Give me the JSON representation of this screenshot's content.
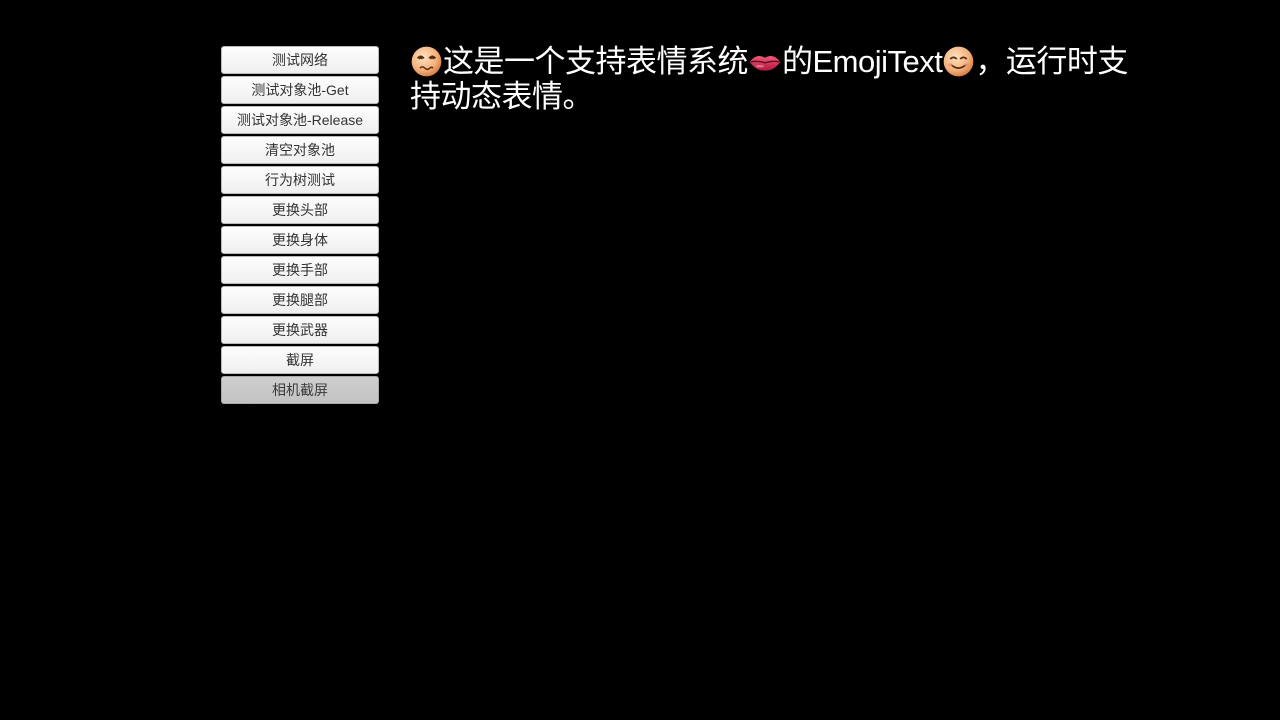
{
  "buttons": [
    {
      "label": "测试网络"
    },
    {
      "label": "测试对象池-Get"
    },
    {
      "label": "测试对象池-Release"
    },
    {
      "label": "清空对象池"
    },
    {
      "label": "行为树测试"
    },
    {
      "label": "更换头部"
    },
    {
      "label": "更换身体"
    },
    {
      "label": "更换手部"
    },
    {
      "label": "更换腿部"
    },
    {
      "label": "更换武器"
    },
    {
      "label": "截屏"
    },
    {
      "label": "相机截屏",
      "state": "pressed"
    }
  ],
  "emoji_text": {
    "emoji_1": "dizzy-face-icon",
    "segment_1": "这是一个支持表情系统",
    "emoji_2": "lips-icon",
    "segment_2": "的EmojiText",
    "emoji_3": "smiling-face-icon",
    "segment_3": "，运行时支持动态表情。"
  },
  "colors": {
    "background": "#000000",
    "text": "#ffffff",
    "button_face": "#f2f2f2",
    "button_pressed": "#c8c8c8",
    "button_text": "#333333"
  }
}
